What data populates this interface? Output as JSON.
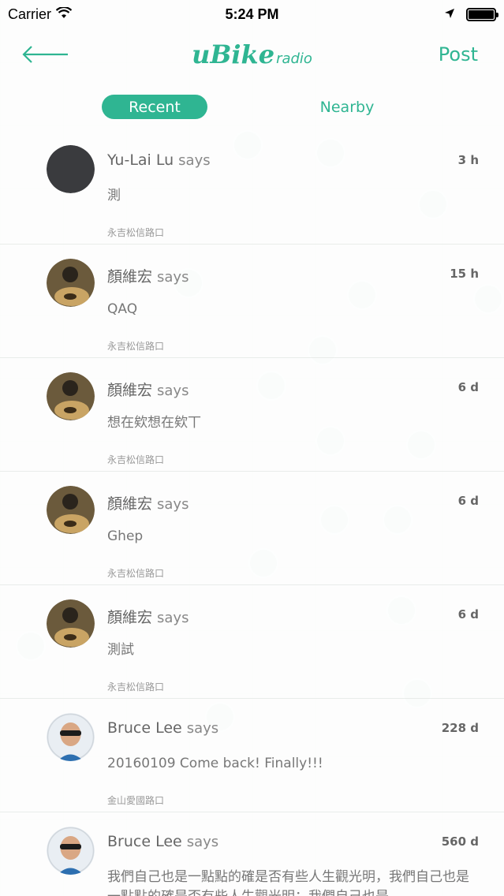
{
  "status_bar": {
    "carrier": "Carrier",
    "time": "5:24 PM"
  },
  "nav": {
    "logo_main": "uBike",
    "logo_sub": "radio",
    "post_label": "Post"
  },
  "tabs": {
    "recent": "Recent",
    "nearby": "Nearby"
  },
  "says_label": "says",
  "accent_color": "#2fb592",
  "posts": [
    {
      "author": "Yu-Lai Lu",
      "time": "3 h",
      "body": "測",
      "location": "永吉松信路口",
      "avatar": "dark-circle"
    },
    {
      "author": "顏維宏",
      "time": "15 h",
      "body": "QAQ",
      "location": "永吉松信路口",
      "avatar": "guitar-player"
    },
    {
      "author": "顏維宏",
      "time": "6 d",
      "body": "想在欸想在欸丅",
      "location": "永吉松信路口",
      "avatar": "guitar-player"
    },
    {
      "author": "顏維宏",
      "time": "6 d",
      "body": "Ghep",
      "location": "永吉松信路口",
      "avatar": "guitar-player"
    },
    {
      "author": "顏維宏",
      "time": "6 d",
      "body": "測試",
      "location": "永吉松信路口",
      "avatar": "guitar-player"
    },
    {
      "author": "Bruce Lee",
      "time": "228 d",
      "body": "20160109 Come back! Finally!!!",
      "location": "金山愛國路口",
      "avatar": "sunglasses-man"
    },
    {
      "author": "Bruce Lee",
      "time": "560 d",
      "body": "我們自己也是一點點的確是否有些人生觀光明，我們自己也是一點點的確是否有些人生觀光明；我們自己也是",
      "location": "",
      "avatar": "sunglasses-man"
    }
  ]
}
